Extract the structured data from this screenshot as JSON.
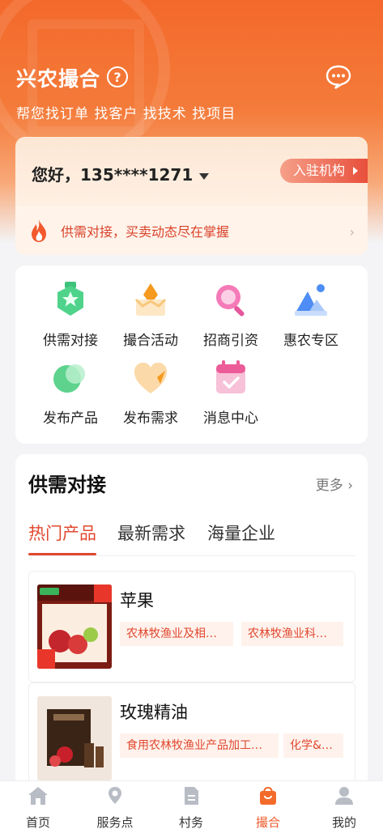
{
  "header": {
    "title": "兴农撮合",
    "help_icon": "help-circle-icon",
    "message_icon": "chat-bubble-icon",
    "subtitle": "帮您找订单 找客户 找技术 找项目"
  },
  "user_card": {
    "greeting": "您好，135****1271",
    "join_button": "入驻机构",
    "notice": "供需对接，买卖动态尽在掌握",
    "notice_icon": "fire-icon"
  },
  "quick_menu": [
    {
      "label": "供需对接",
      "icon": "supply-demand-badge-icon"
    },
    {
      "label": "撮合活动",
      "icon": "activity-crown-icon"
    },
    {
      "label": "招商引资",
      "icon": "magnifier-icon"
    },
    {
      "label": "惠农专区",
      "icon": "mountain-icon"
    },
    {
      "label": "发布产品",
      "icon": "publish-product-icon"
    },
    {
      "label": "发布需求",
      "icon": "heart-icon"
    },
    {
      "label": "消息中心",
      "icon": "calendar-check-icon"
    }
  ],
  "supply_section": {
    "title": "供需对接",
    "more": "更多",
    "tabs": [
      "热门产品",
      "最新需求",
      "海量企业"
    ],
    "active_tab": 0,
    "products": [
      {
        "name": "苹果",
        "tags": [
          "农林牧渔业及相…",
          "农林牧渔业科…"
        ]
      },
      {
        "name": "玫瑰精油",
        "tags": [
          "食用农林牧渔业产品加工…",
          "化学&…"
        ]
      }
    ]
  },
  "tabbar": {
    "items": [
      {
        "label": "首页",
        "icon": "home-icon"
      },
      {
        "label": "服务点",
        "icon": "location-pin-icon"
      },
      {
        "label": "村务",
        "icon": "document-icon"
      },
      {
        "label": "撮合",
        "icon": "shopping-bag-icon"
      },
      {
        "label": "我的",
        "icon": "user-icon"
      }
    ],
    "active_index": 3
  },
  "colors": {
    "brand_orange": "#f3692b",
    "accent_red": "#e0482f"
  }
}
